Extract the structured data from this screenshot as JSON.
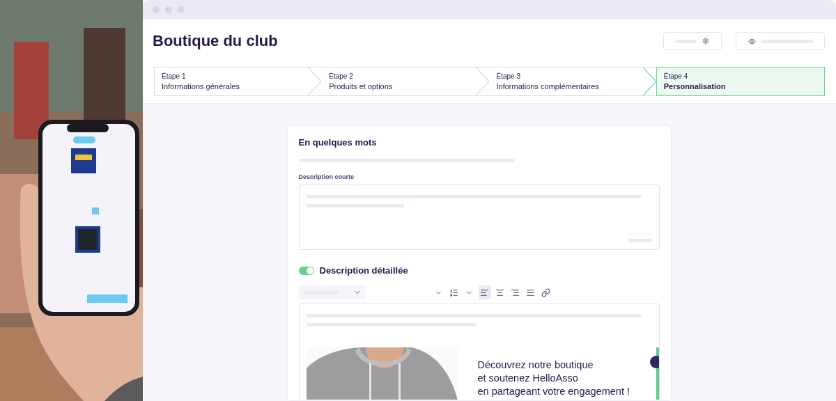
{
  "photo": {
    "kind": "picture"
  },
  "window": {
    "title": "Boutique du club"
  },
  "steps": [
    {
      "number": "Étape 1",
      "label": "Informations générales",
      "selected": false
    },
    {
      "number": "Étape 2",
      "label": "Produits et options",
      "selected": false
    },
    {
      "number": "Étape 3",
      "label": "Informations complémentaires",
      "selected": false
    },
    {
      "number": "Étape 4",
      "label": "Personnalisation",
      "selected": true
    }
  ],
  "card": {
    "title": "En quelques mots",
    "short_description": {
      "label": "Description courte"
    },
    "detailed_description": {
      "label": "Description détaillée",
      "on": true
    },
    "toolbar": [
      {
        "kind": "dropdown"
      },
      {
        "kind": "chevron",
        "selected": false
      },
      {
        "kind": "ordered-list",
        "selected": false
      },
      {
        "kind": "chevron",
        "selected": false
      },
      {
        "kind": "align-left",
        "selected": true
      },
      {
        "kind": "align-center",
        "selected": false
      },
      {
        "kind": "align-right",
        "selected": false
      },
      {
        "kind": "align-justify",
        "selected": false
      },
      {
        "kind": "link",
        "selected": false
      }
    ],
    "banner": {
      "picture": {
        "kind": "picture"
      },
      "lines": [
        "Découvrez notre boutique",
        "et soutenez HelloAsso",
        "en partageant votre engagement !"
      ]
    }
  }
}
